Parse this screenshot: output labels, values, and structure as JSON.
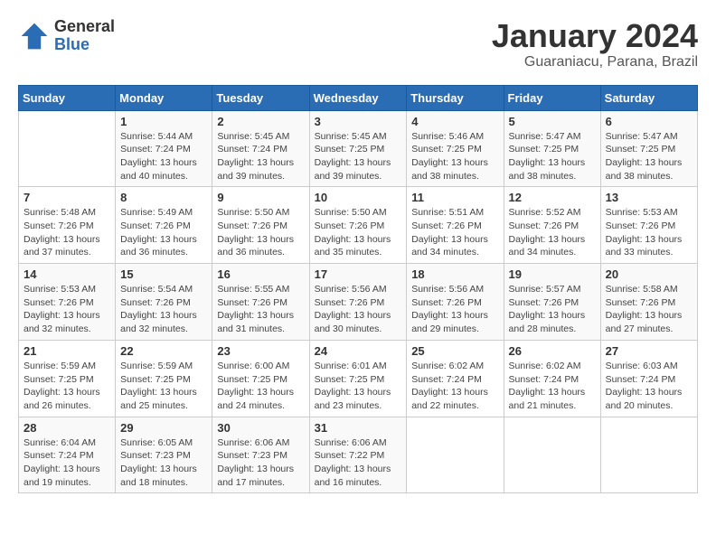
{
  "header": {
    "logo": {
      "line1": "General",
      "line2": "Blue"
    },
    "title": "January 2024",
    "subtitle": "Guaraniacu, Parana, Brazil"
  },
  "weekdays": [
    "Sunday",
    "Monday",
    "Tuesday",
    "Wednesday",
    "Thursday",
    "Friday",
    "Saturday"
  ],
  "weeks": [
    [
      {
        "day": "",
        "info": ""
      },
      {
        "day": "1",
        "info": "Sunrise: 5:44 AM\nSunset: 7:24 PM\nDaylight: 13 hours\nand 40 minutes."
      },
      {
        "day": "2",
        "info": "Sunrise: 5:45 AM\nSunset: 7:24 PM\nDaylight: 13 hours\nand 39 minutes."
      },
      {
        "day": "3",
        "info": "Sunrise: 5:45 AM\nSunset: 7:25 PM\nDaylight: 13 hours\nand 39 minutes."
      },
      {
        "day": "4",
        "info": "Sunrise: 5:46 AM\nSunset: 7:25 PM\nDaylight: 13 hours\nand 38 minutes."
      },
      {
        "day": "5",
        "info": "Sunrise: 5:47 AM\nSunset: 7:25 PM\nDaylight: 13 hours\nand 38 minutes."
      },
      {
        "day": "6",
        "info": "Sunrise: 5:47 AM\nSunset: 7:25 PM\nDaylight: 13 hours\nand 38 minutes."
      }
    ],
    [
      {
        "day": "7",
        "info": "Sunrise: 5:48 AM\nSunset: 7:26 PM\nDaylight: 13 hours\nand 37 minutes."
      },
      {
        "day": "8",
        "info": "Sunrise: 5:49 AM\nSunset: 7:26 PM\nDaylight: 13 hours\nand 36 minutes."
      },
      {
        "day": "9",
        "info": "Sunrise: 5:50 AM\nSunset: 7:26 PM\nDaylight: 13 hours\nand 36 minutes."
      },
      {
        "day": "10",
        "info": "Sunrise: 5:50 AM\nSunset: 7:26 PM\nDaylight: 13 hours\nand 35 minutes."
      },
      {
        "day": "11",
        "info": "Sunrise: 5:51 AM\nSunset: 7:26 PM\nDaylight: 13 hours\nand 34 minutes."
      },
      {
        "day": "12",
        "info": "Sunrise: 5:52 AM\nSunset: 7:26 PM\nDaylight: 13 hours\nand 34 minutes."
      },
      {
        "day": "13",
        "info": "Sunrise: 5:53 AM\nSunset: 7:26 PM\nDaylight: 13 hours\nand 33 minutes."
      }
    ],
    [
      {
        "day": "14",
        "info": "Sunrise: 5:53 AM\nSunset: 7:26 PM\nDaylight: 13 hours\nand 32 minutes."
      },
      {
        "day": "15",
        "info": "Sunrise: 5:54 AM\nSunset: 7:26 PM\nDaylight: 13 hours\nand 32 minutes."
      },
      {
        "day": "16",
        "info": "Sunrise: 5:55 AM\nSunset: 7:26 PM\nDaylight: 13 hours\nand 31 minutes."
      },
      {
        "day": "17",
        "info": "Sunrise: 5:56 AM\nSunset: 7:26 PM\nDaylight: 13 hours\nand 30 minutes."
      },
      {
        "day": "18",
        "info": "Sunrise: 5:56 AM\nSunset: 7:26 PM\nDaylight: 13 hours\nand 29 minutes."
      },
      {
        "day": "19",
        "info": "Sunrise: 5:57 AM\nSunset: 7:26 PM\nDaylight: 13 hours\nand 28 minutes."
      },
      {
        "day": "20",
        "info": "Sunrise: 5:58 AM\nSunset: 7:26 PM\nDaylight: 13 hours\nand 27 minutes."
      }
    ],
    [
      {
        "day": "21",
        "info": "Sunrise: 5:59 AM\nSunset: 7:25 PM\nDaylight: 13 hours\nand 26 minutes."
      },
      {
        "day": "22",
        "info": "Sunrise: 5:59 AM\nSunset: 7:25 PM\nDaylight: 13 hours\nand 25 minutes."
      },
      {
        "day": "23",
        "info": "Sunrise: 6:00 AM\nSunset: 7:25 PM\nDaylight: 13 hours\nand 24 minutes."
      },
      {
        "day": "24",
        "info": "Sunrise: 6:01 AM\nSunset: 7:25 PM\nDaylight: 13 hours\nand 23 minutes."
      },
      {
        "day": "25",
        "info": "Sunrise: 6:02 AM\nSunset: 7:24 PM\nDaylight: 13 hours\nand 22 minutes."
      },
      {
        "day": "26",
        "info": "Sunrise: 6:02 AM\nSunset: 7:24 PM\nDaylight: 13 hours\nand 21 minutes."
      },
      {
        "day": "27",
        "info": "Sunrise: 6:03 AM\nSunset: 7:24 PM\nDaylight: 13 hours\nand 20 minutes."
      }
    ],
    [
      {
        "day": "28",
        "info": "Sunrise: 6:04 AM\nSunset: 7:24 PM\nDaylight: 13 hours\nand 19 minutes."
      },
      {
        "day": "29",
        "info": "Sunrise: 6:05 AM\nSunset: 7:23 PM\nDaylight: 13 hours\nand 18 minutes."
      },
      {
        "day": "30",
        "info": "Sunrise: 6:06 AM\nSunset: 7:23 PM\nDaylight: 13 hours\nand 17 minutes."
      },
      {
        "day": "31",
        "info": "Sunrise: 6:06 AM\nSunset: 7:22 PM\nDaylight: 13 hours\nand 16 minutes."
      },
      {
        "day": "",
        "info": ""
      },
      {
        "day": "",
        "info": ""
      },
      {
        "day": "",
        "info": ""
      }
    ]
  ]
}
